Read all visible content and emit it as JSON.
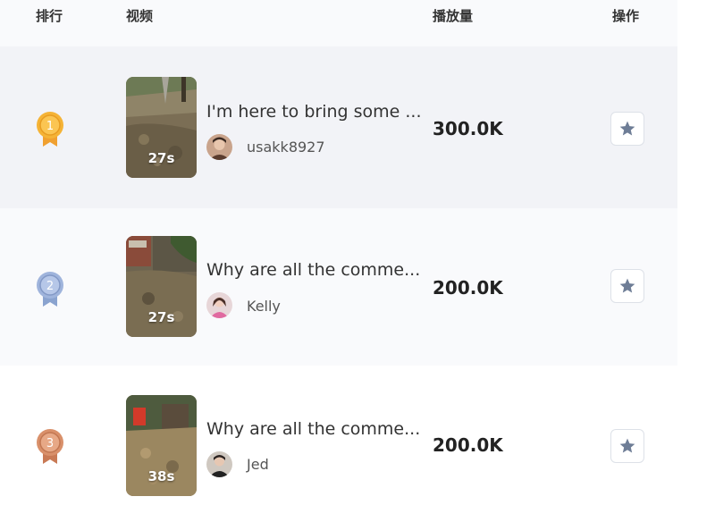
{
  "header": {
    "rank": "排行",
    "video": "视频",
    "views": "播放量",
    "actions": "操作"
  },
  "rows": [
    {
      "rank": "1",
      "medal": "gold-medal-icon",
      "duration": "27s",
      "title": "I'm here to bring some ...",
      "author": "usakk8927",
      "views": "300.0K",
      "action_icon": "star-icon"
    },
    {
      "rank": "2",
      "medal": "silver-medal-icon",
      "duration": "27s",
      "title": "Why are all the comme...",
      "author": "Kelly",
      "views": "200.0K",
      "action_icon": "star-icon"
    },
    {
      "rank": "3",
      "medal": "bronze-medal-icon",
      "duration": "38s",
      "title": "Why are all the comme...",
      "author": "Jed",
      "views": "200.0K",
      "action_icon": "star-icon"
    }
  ],
  "colors": {
    "gold": "#f5b336",
    "silver": "#9fb4dc",
    "bronze": "#d9906a",
    "star": "#6e7d96"
  }
}
